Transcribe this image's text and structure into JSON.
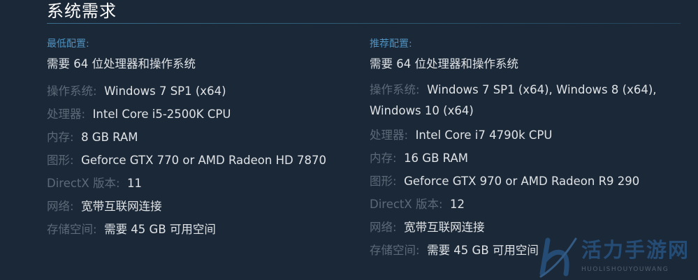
{
  "section": {
    "title": "系统需求"
  },
  "minimum": {
    "heading": "最低配置:",
    "requires_64": "需要 64 位处理器和操作系统",
    "specs": [
      {
        "label": "操作系统:",
        "value": "Windows 7 SP1 (x64)"
      },
      {
        "label": "处理器:",
        "value": "Intel Core i5-2500K CPU"
      },
      {
        "label": "内存:",
        "value": "8 GB RAM"
      },
      {
        "label": "图形:",
        "value": "Geforce GTX 770 or AMD Radeon HD 7870"
      },
      {
        "label": "DirectX 版本:",
        "value": "11"
      },
      {
        "label": "网络:",
        "value": "宽带互联网连接"
      },
      {
        "label": "存储空间:",
        "value": "需要 45 GB 可用空间"
      }
    ]
  },
  "recommended": {
    "heading": "推荐配置:",
    "requires_64": "需要 64 位处理器和操作系统",
    "specs": [
      {
        "label": "操作系统:",
        "value": "Windows 7 SP1 (x64), Windows 8 (x64),",
        "value_cont": "Windows 10 (x64)"
      },
      {
        "label": "处理器:",
        "value": "Intel Core i7 4790k CPU"
      },
      {
        "label": "内存:",
        "value": "16 GB RAM"
      },
      {
        "label": "图形:",
        "value": "Geforce GTX 970 or AMD Radeon R9 290"
      },
      {
        "label": "DirectX 版本:",
        "value": "12"
      },
      {
        "label": "网络:",
        "value": "宽带互联网连接"
      },
      {
        "label": "存储空间:",
        "value": "需要 45 GB 可用空间"
      }
    ]
  },
  "watermark": {
    "name_cn": "活力手游网",
    "name_en": "HUOLISHOUYOUWANG",
    "logo_icon": "h-logo-icon"
  },
  "colors": {
    "background": "#1b2838",
    "heading_blue": "#4e92c0",
    "label_gray": "#5c6a78",
    "value_light": "#dfe3e6"
  }
}
